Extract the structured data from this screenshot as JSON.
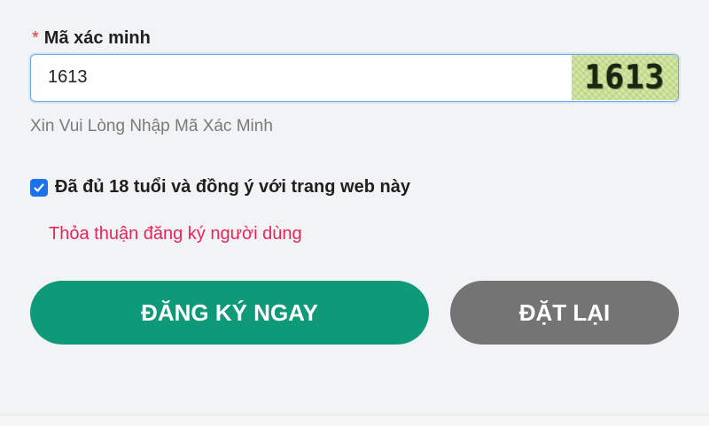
{
  "captcha_field": {
    "required_mark": "*",
    "label": "Mã xác minh",
    "value": "1613",
    "image_text": "1613",
    "hint": "Xin Vui Lòng Nhập Mã Xác Minh"
  },
  "agreement": {
    "checked": true,
    "label": "Đã đủ 18 tuổi và đồng ý với trang web này",
    "link_text": "Thỏa thuận đăng ký người dùng"
  },
  "buttons": {
    "register_label": "ĐĂNG KÝ NGAY",
    "reset_label": "ĐẶT LẠI"
  },
  "colors": {
    "register_button": "#0e9a79",
    "reset_button": "#747474",
    "link": "#e8245a",
    "required": "#e0353b",
    "checkbox": "#1a73e8"
  }
}
